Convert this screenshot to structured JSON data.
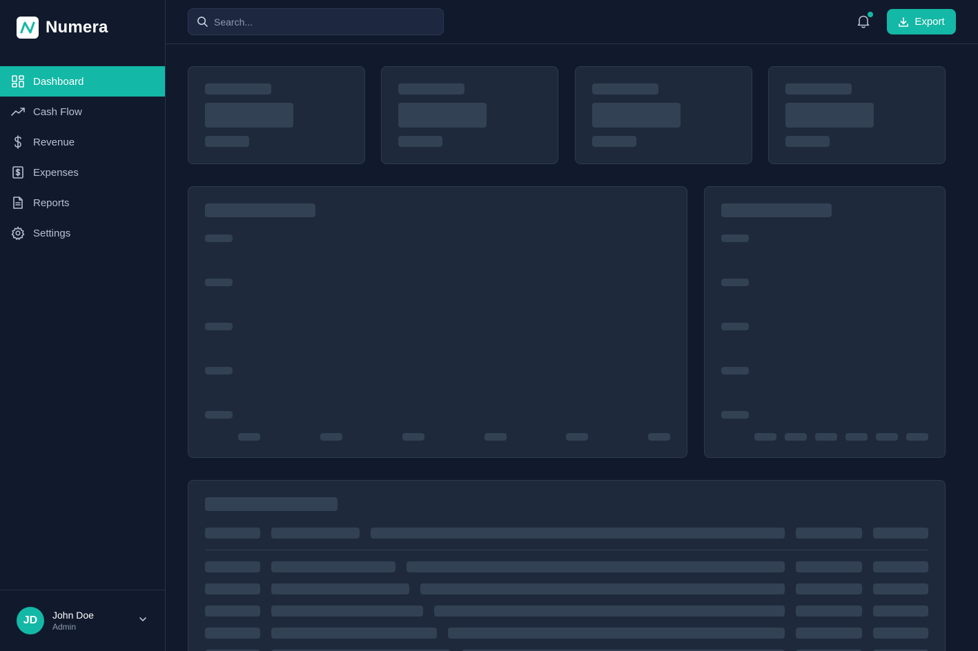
{
  "brand": {
    "name": "Numera"
  },
  "nav": {
    "items": [
      {
        "label": "Dashboard",
        "icon": "layout-grid-icon",
        "active": true
      },
      {
        "label": "Cash Flow",
        "icon": "trending-up-icon",
        "active": false
      },
      {
        "label": "Revenue",
        "icon": "dollar-sign-icon",
        "active": false
      },
      {
        "label": "Expenses",
        "icon": "receipt-icon",
        "active": false
      },
      {
        "label": "Reports",
        "icon": "file-text-icon",
        "active": false
      },
      {
        "label": "Settings",
        "icon": "gear-icon",
        "active": false
      }
    ]
  },
  "user": {
    "initials": "JD",
    "name": "John Doe",
    "role": "Admin"
  },
  "header": {
    "search_placeholder": "Search...",
    "export_label": "Export",
    "notification_unread": true
  },
  "main": {
    "state": "loading",
    "kpi_card_count": 4,
    "charts": [
      "main-chart",
      "side-chart"
    ],
    "table_loading_rows": 4
  },
  "colors": {
    "accent": "#14b8a6",
    "background": "#111a2d",
    "card": "#1e293b",
    "skeleton": "#334155"
  }
}
